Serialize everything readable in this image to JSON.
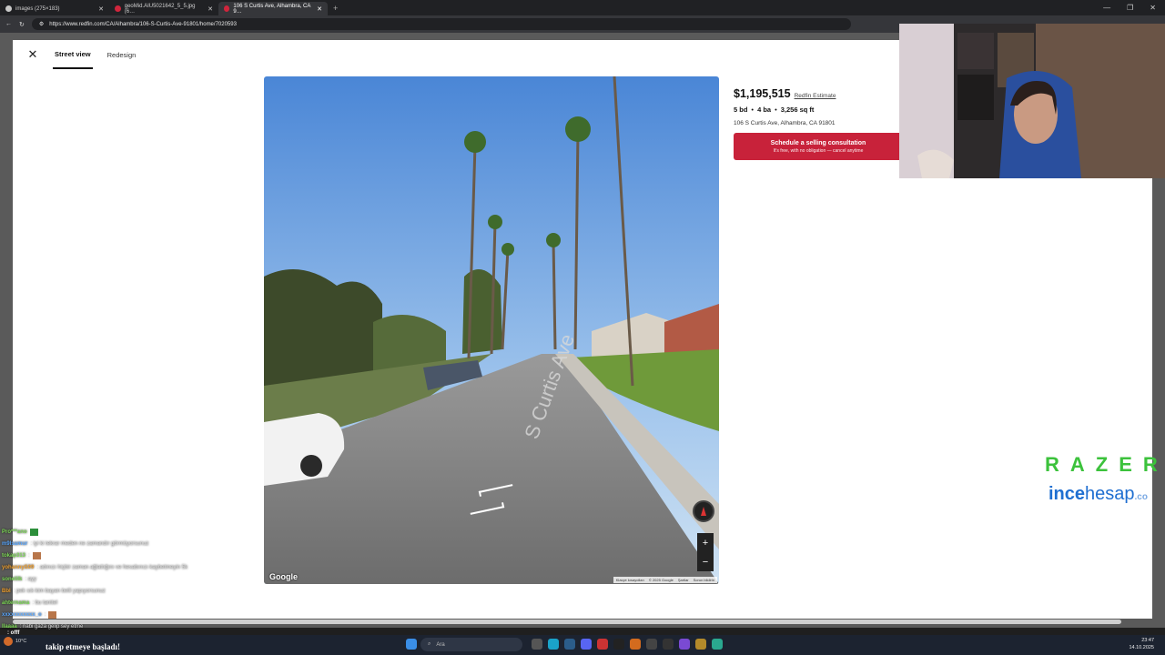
{
  "browser": {
    "tabs": [
      {
        "title": "images (275×183)"
      },
      {
        "title": "geoMid.AIU5021642_5_5.jpg (6…"
      },
      {
        "title": "106 S Curtis Ave, Alhambra, CA 9…"
      }
    ],
    "url": "https://www.redfin.com/CA/Alhambra/106-S-Curtis-Ave-91801/home/7020593"
  },
  "modal": {
    "tabs": [
      {
        "label": "Street view"
      },
      {
        "label": "Redesign"
      }
    ]
  },
  "streetview": {
    "street_label": "S Curtis Ave",
    "google": "Google",
    "attribution": [
      "Klavye kısayolları",
      "© 2025 Google",
      "Şartlar",
      "Sorun bildirin"
    ],
    "zoom_in": "+",
    "zoom_out": "−"
  },
  "listing": {
    "price": "$1,195,515",
    "estimate_label": "Redfin Estimate",
    "beds": "5 bd",
    "baths": "4 ba",
    "sqft": "3,256 sq ft",
    "address": "106 S Curtis Ave, Alhambra, CA 91801",
    "cta_title": "Schedule a selling consultation",
    "cta_sub": "It's free, with no obligation — cancel anytime"
  },
  "overlay": {
    "brand1": "RAZER",
    "brand2_bold": "ince",
    "brand2_rest": "hesap",
    "brand2_tld": ".co",
    "follow_alert": "takip etmeye başladı!",
    "chat": [
      {
        "user": "Pro***ano",
        "text": ""
      },
      {
        "user": "m9lsamur",
        "text": ": iyi ki tekrar meden ne zamandır görmüyorsunuz"
      },
      {
        "user": "tokap313",
        "text": ":"
      },
      {
        "user": "yohannyS09",
        "text": ": adınızı hiçbir zaman ağlattığını ve hesabınızı kaybetmeyin 5k"
      },
      {
        "user": "sonelilk",
        "text": ": ayy"
      },
      {
        "user": "Bbl",
        "text": ": pek sık kim bayan belli yapıyorsunuz"
      },
      {
        "user": "ahternama",
        "text": ": bu tanitel"
      },
      {
        "user": "xxxxxxxxxxx_o",
        "text": ":"
      },
      {
        "user": "llaaaa",
        "text": ": nabi gaza gelip sey etme"
      }
    ],
    "last_chat": ": offf"
  },
  "taskbar": {
    "weather": "10°C",
    "search_placeholder": "Ara",
    "time": "23:47",
    "date": "14.10.2025"
  }
}
